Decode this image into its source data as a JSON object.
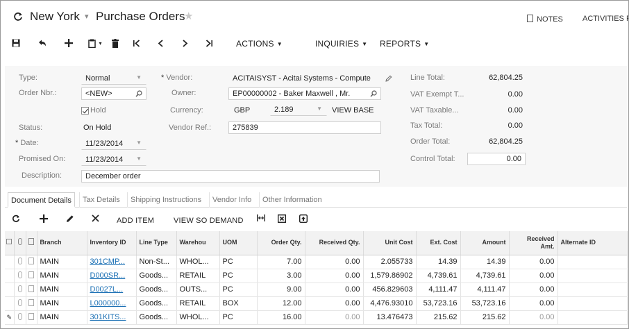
{
  "header": {
    "company": "New York",
    "separator": "▾",
    "screen": "Purchase Orders",
    "notes_label": "NOTES",
    "activities_label": "ACTIVITIES",
    "files_label": "F"
  },
  "toolbar": {
    "actions_label": "ACTIONS",
    "inquiries_label": "INQUIRIES",
    "reports_label": "REPORTS"
  },
  "form": {
    "type_label": "Type:",
    "type_value": "Normal",
    "order_nbr_label": "Order Nbr.:",
    "order_nbr_value": "<NEW>",
    "hold_label": "Hold",
    "status_label": "Status:",
    "status_value": "On Hold",
    "date_label": "Date:",
    "date_value": "11/23/2014",
    "promised_on_label": "Promised On:",
    "promised_on_value": "11/23/2014",
    "description_label": "Description:",
    "description_value": "December order",
    "vendor_label": "Vendor:",
    "vendor_value": "ACITAISYST - Acitai Systems - Compute",
    "owner_label": "Owner:",
    "owner_value": "EP00000002 - Baker Maxwell , Mr.",
    "currency_label": "Currency:",
    "currency_value": "GBP",
    "currency_rate": "2.189",
    "view_base_label": "VIEW BASE",
    "vendor_ref_label": "Vendor Ref.:",
    "vendor_ref_value": "275839",
    "line_total_label": "Line Total:",
    "line_total_value": "62,804.25",
    "vat_exempt_label": "VAT Exempt T...",
    "vat_exempt_value": "0.00",
    "vat_taxable_label": "VAT Taxable...",
    "vat_taxable_value": "0.00",
    "tax_total_label": "Tax Total:",
    "tax_total_value": "0.00",
    "order_total_label": "Order Total:",
    "order_total_value": "62,804.25",
    "control_total_label": "Control Total:",
    "control_total_value": "0.00"
  },
  "tabs": [
    {
      "label": "Document Details"
    },
    {
      "label": "Tax Details"
    },
    {
      "label": "Shipping Instructions"
    },
    {
      "label": "Vendor Info"
    },
    {
      "label": "Other Information"
    }
  ],
  "grid_toolbar": {
    "add_item_label": "ADD ITEM",
    "view_so_demand_label": "VIEW SO DEMAND"
  },
  "grid": {
    "columns": {
      "branch": "Branch",
      "inventory_id": "Inventory ID",
      "line_type": "Line Type",
      "warehouse": "Warehou",
      "uom": "UOM",
      "order_qty": "Order Qty.",
      "received_qty": "Received Qty.",
      "unit_cost": "Unit Cost",
      "ext_cost": "Ext. Cost",
      "amount": "Amount",
      "received_amt": "Received Amt.",
      "alternate_id": "Alternate ID"
    },
    "rows": [
      {
        "branch": "MAIN",
        "inventory_id": "301CMP...",
        "line_type": "Non-St...",
        "warehouse": "WHOL...",
        "uom": "PC",
        "order_qty": "7.00",
        "received_qty": "0.00",
        "unit_cost": "2.055733",
        "ext_cost": "14.39",
        "amount": "14.39",
        "received_amt": "0.00",
        "alternate_id": ""
      },
      {
        "branch": "MAIN",
        "inventory_id": "D000SR...",
        "line_type": "Goods...",
        "warehouse": "RETAIL",
        "uom": "PC",
        "order_qty": "3.00",
        "received_qty": "0.00",
        "unit_cost": "1,579.86902",
        "ext_cost": "4,739.61",
        "amount": "4,739.61",
        "received_amt": "0.00",
        "alternate_id": ""
      },
      {
        "branch": "MAIN",
        "inventory_id": "D0027L...",
        "line_type": "Goods...",
        "warehouse": "OUTS...",
        "uom": "PC",
        "order_qty": "9.00",
        "received_qty": "0.00",
        "unit_cost": "456.829603",
        "ext_cost": "4,111.47",
        "amount": "4,111.47",
        "received_amt": "0.00",
        "alternate_id": ""
      },
      {
        "branch": "MAIN",
        "inventory_id": "L000000...",
        "line_type": "Goods...",
        "warehouse": "RETAIL",
        "uom": "BOX",
        "order_qty": "12.00",
        "received_qty": "0.00",
        "unit_cost": "4,476.93010",
        "ext_cost": "53,723.16",
        "amount": "53,723.16",
        "received_amt": "0.00",
        "alternate_id": ""
      },
      {
        "branch": "MAIN",
        "inventory_id": "301KITS...",
        "line_type": "Goods...",
        "warehouse": "WHOL...",
        "uom": "PC",
        "order_qty": "16.00",
        "received_qty": "0.00",
        "unit_cost": "13.476473",
        "ext_cost": "215.62",
        "amount": "215.62",
        "received_amt": "0.00",
        "alternate_id": ""
      }
    ]
  }
}
